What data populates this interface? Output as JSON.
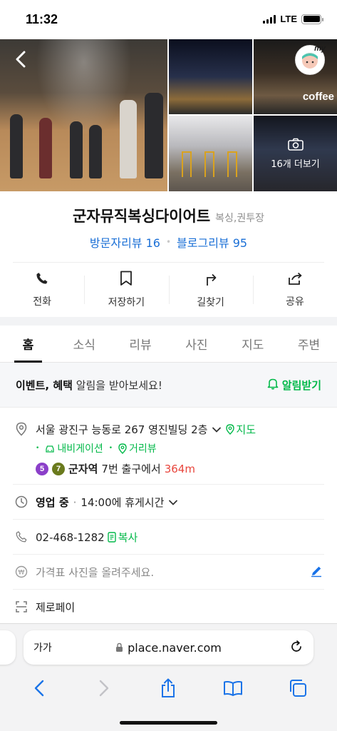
{
  "status_bar": {
    "time": "11:32",
    "network": "LTE"
  },
  "photos": {
    "more_label": "16개 더보기",
    "coffee_sign": "coffee"
  },
  "avatar": {
    "badge": "my"
  },
  "place": {
    "name": "군자뮤직복싱다이어트",
    "category": "복싱,권투장",
    "visitor_reviews": "방문자리뷰 16",
    "blog_reviews": "블로그리뷰 95"
  },
  "actions": [
    {
      "label": "전화",
      "icon": "phone-icon"
    },
    {
      "label": "저장하기",
      "icon": "bookmark-icon"
    },
    {
      "label": "길찾기",
      "icon": "directions-icon"
    },
    {
      "label": "공유",
      "icon": "share-icon"
    }
  ],
  "tabs": [
    {
      "label": "홈",
      "active": true
    },
    {
      "label": "소식"
    },
    {
      "label": "리뷰"
    },
    {
      "label": "사진"
    },
    {
      "label": "지도"
    },
    {
      "label": "주변"
    }
  ],
  "event_banner": {
    "bold_text": "이벤트, 혜택",
    "text": " 알림을 받아보세요!",
    "button": "알림받기"
  },
  "address": {
    "text": "서울 광진구 능동로 267 영진빌딩 2층",
    "map_link": "지도",
    "navigation_link": "내비게이션",
    "street_view_link": "거리뷰",
    "subway": {
      "lines": [
        {
          "number": "5",
          "color": "#8b3fc9"
        },
        {
          "number": "7",
          "color": "#6a7a1d"
        }
      ],
      "station": "군자역",
      "exit": "7번 출구에서",
      "distance": "364m"
    }
  },
  "hours": {
    "status": "영업 중",
    "separator": "·",
    "detail": "14:00에 휴게시간"
  },
  "phone": {
    "number": "02-468-1282",
    "copy_label": "복사"
  },
  "price": {
    "placeholder": "가격표 사진을 올려주세요."
  },
  "zeropay": {
    "label": "제로페이"
  },
  "browser": {
    "text_size": "가가",
    "url": "place.naver.com"
  },
  "colors": {
    "naver_green": "#03b94a",
    "link_blue": "#1a6fd6",
    "distance_red": "#e8453c",
    "ios_blue": "#1a73e8"
  }
}
